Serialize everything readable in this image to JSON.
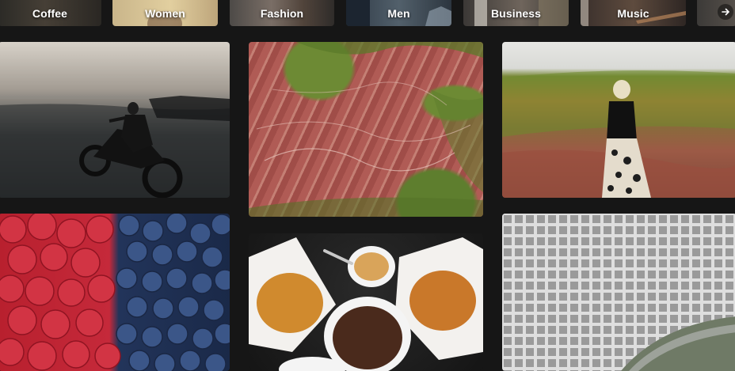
{
  "categories": [
    {
      "label": "Coffee"
    },
    {
      "label": "Women"
    },
    {
      "label": "Fashion"
    },
    {
      "label": "Men"
    },
    {
      "label": "Business"
    },
    {
      "label": "Music"
    }
  ],
  "next_icon": "chevron-right-icon",
  "photos": [
    {
      "subject": "motorcycle-beach"
    },
    {
      "subject": "aerial-red-land"
    },
    {
      "subject": "woman-landscape"
    },
    {
      "subject": "raspberries-blueberries"
    },
    {
      "subject": "food-platters"
    },
    {
      "subject": "white-grid-architecture"
    }
  ],
  "colors": {
    "background": "#161616",
    "label": "#ffffff"
  }
}
